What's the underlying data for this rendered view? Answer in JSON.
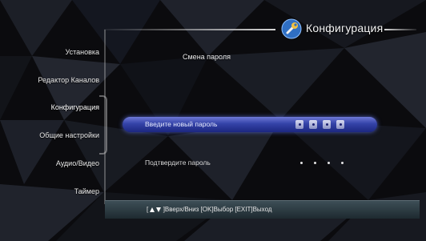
{
  "header": {
    "title": "Конфигурация",
    "icon": "wrench-icon"
  },
  "sidebar": {
    "items": [
      {
        "label": "Установка"
      },
      {
        "label": "Редактор Каналов"
      },
      {
        "label": "Конфигурация"
      },
      {
        "label": "Общие настройки"
      },
      {
        "label": "Аудио/Видео"
      },
      {
        "label": "Таймер"
      }
    ],
    "active_index": 2
  },
  "main": {
    "section_title": "Смена пароля",
    "new_password": {
      "label": "Введите новый пароль",
      "digits_entered": 4
    },
    "confirm_password": {
      "label": "Подтвердите пароль",
      "digits_entered": 4
    }
  },
  "help_bar": {
    "text_open": "[",
    "text_rest": "]Вверх/Вниз [OK]Выбор [EXIT]Выход"
  },
  "colors": {
    "selection": "#3443a8",
    "background": "#0a0a0c",
    "help_bar": "#2a383e"
  }
}
